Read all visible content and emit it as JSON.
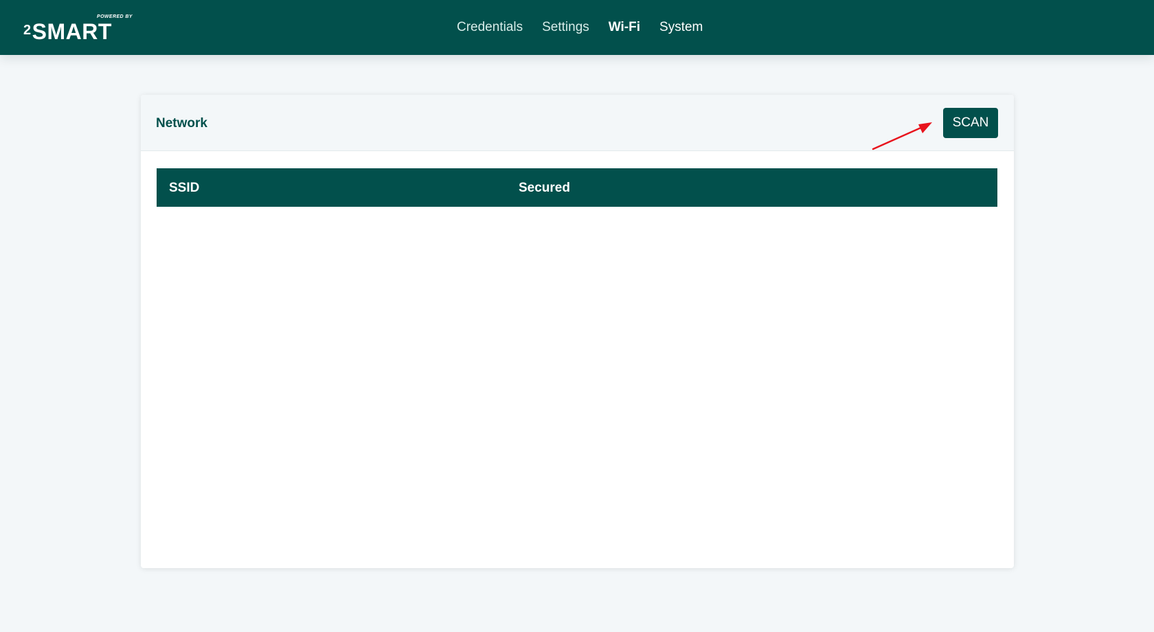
{
  "brand": {
    "powered_by": "POWERED BY",
    "superscript": "2",
    "name": "SMART"
  },
  "nav": {
    "items": [
      {
        "label": "Credentials"
      },
      {
        "label": "Settings"
      },
      {
        "label": "Wi-Fi"
      },
      {
        "label": "System"
      }
    ],
    "active": "Wi-Fi"
  },
  "card": {
    "title": "Network",
    "scan_label": "SCAN",
    "table": {
      "columns": [
        "SSID",
        "Secured"
      ],
      "rows": []
    }
  },
  "colors": {
    "primary": "#02504c",
    "background": "#f3f7f9",
    "annotation_arrow": "#e8141d"
  },
  "icons": {
    "annotation": "red-arrow-icon"
  }
}
